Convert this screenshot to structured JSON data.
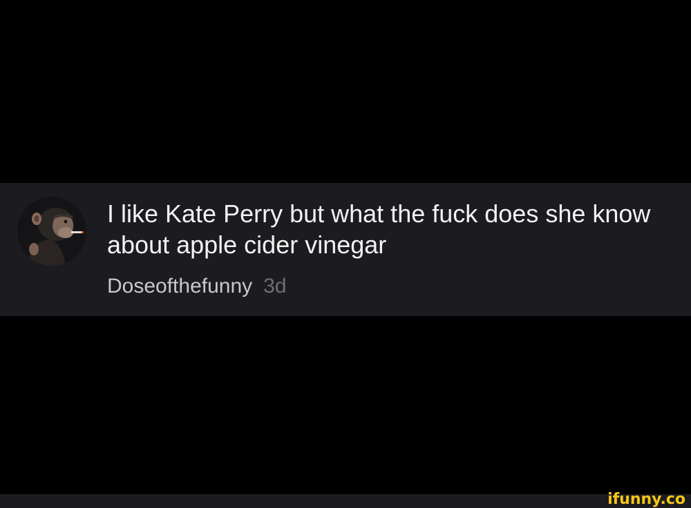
{
  "comment": {
    "text": "I like Kate Perry but what the fuck does she know about apple cider vinegar",
    "author": "Doseofthefunny",
    "age": "3d",
    "avatar_icon": "smoking-monkey-avatar"
  },
  "watermark": {
    "text": "ifunny.co",
    "color": "#f5c518"
  },
  "colors": {
    "background": "#000000",
    "card": "#1c1c20",
    "comment_text": "#f2f2f2",
    "author_text": "#c9c9cc",
    "timestamp_text": "#6e6e73"
  }
}
